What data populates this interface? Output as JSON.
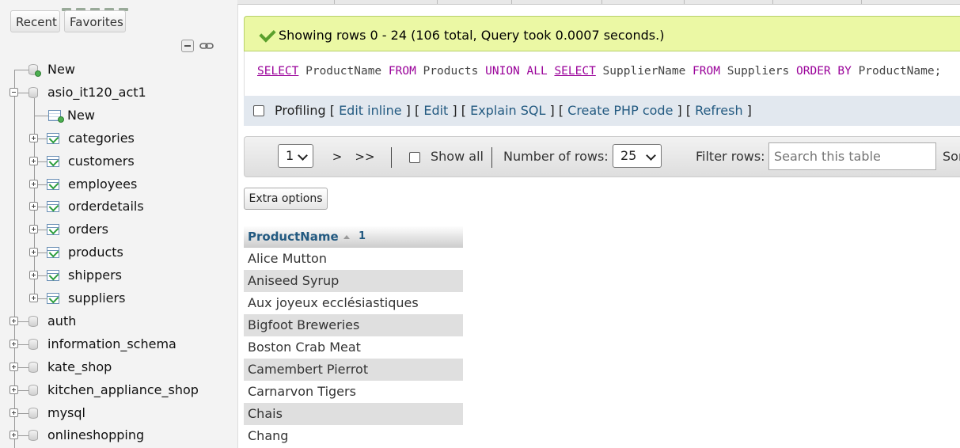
{
  "sidebar": {
    "recent_label": "Recent",
    "favorites_label": "Favorites",
    "tree": [
      {
        "label": "New",
        "level": 0,
        "kind": "new-db"
      },
      {
        "label": "asio_it120_act1",
        "level": 0,
        "kind": "db",
        "expanded": true
      },
      {
        "label": "New",
        "level": 1,
        "kind": "new-table"
      },
      {
        "label": "categories",
        "level": 1,
        "kind": "table"
      },
      {
        "label": "customers",
        "level": 1,
        "kind": "table"
      },
      {
        "label": "employees",
        "level": 1,
        "kind": "table"
      },
      {
        "label": "orderdetails",
        "level": 1,
        "kind": "table"
      },
      {
        "label": "orders",
        "level": 1,
        "kind": "table"
      },
      {
        "label": "products",
        "level": 1,
        "kind": "table"
      },
      {
        "label": "shippers",
        "level": 1,
        "kind": "table"
      },
      {
        "label": "suppliers",
        "level": 1,
        "kind": "table"
      },
      {
        "label": "auth",
        "level": 0,
        "kind": "db"
      },
      {
        "label": "information_schema",
        "level": 0,
        "kind": "db"
      },
      {
        "label": "kate_shop",
        "level": 0,
        "kind": "db"
      },
      {
        "label": "kitchen_appliance_shop",
        "level": 0,
        "kind": "db"
      },
      {
        "label": "mysql",
        "level": 0,
        "kind": "db"
      },
      {
        "label": "onlineshopping",
        "level": 0,
        "kind": "db"
      }
    ]
  },
  "success": {
    "message": "Showing rows 0 - 24 (106 total, Query took 0.0007 seconds.)"
  },
  "sql": {
    "tokens": [
      {
        "t": "SELECT",
        "c": "kw-u"
      },
      {
        "t": " ProductName ",
        "c": ""
      },
      {
        "t": "FROM",
        "c": "kw"
      },
      {
        "t": " Products ",
        "c": ""
      },
      {
        "t": "UNION ALL",
        "c": "kw"
      },
      {
        "t": " ",
        "c": ""
      },
      {
        "t": "SELECT",
        "c": "kw-u"
      },
      {
        "t": " SupplierName ",
        "c": ""
      },
      {
        "t": "FROM",
        "c": "kw"
      },
      {
        "t": " Suppliers ",
        "c": ""
      },
      {
        "t": "ORDER BY",
        "c": "kw"
      },
      {
        "t": " ProductName;",
        "c": ""
      }
    ]
  },
  "profiling": {
    "label": "Profiling",
    "links": [
      "Edit inline",
      "Edit",
      "Explain SQL",
      "Create PHP code",
      "Refresh"
    ]
  },
  "nav": {
    "page_value": "1",
    "next_label": ">",
    "last_label": ">>",
    "show_all_label": "Show all",
    "rows_label": "Number of rows:",
    "rows_value": "25",
    "filter_label": "Filter rows:",
    "filter_placeholder": "Search this table",
    "sort_label_partial": "Sor"
  },
  "extra_options_label": "Extra options",
  "results": {
    "column": "ProductName",
    "sort_index": "1",
    "rows": [
      "Alice Mutton",
      "Aniseed Syrup",
      "Aux joyeux ecclésiastiques",
      "Bigfoot Breweries",
      "Boston Crab Meat",
      "Camembert Pierrot",
      "Carnarvon Tigers",
      "Chais",
      "Chang"
    ]
  }
}
